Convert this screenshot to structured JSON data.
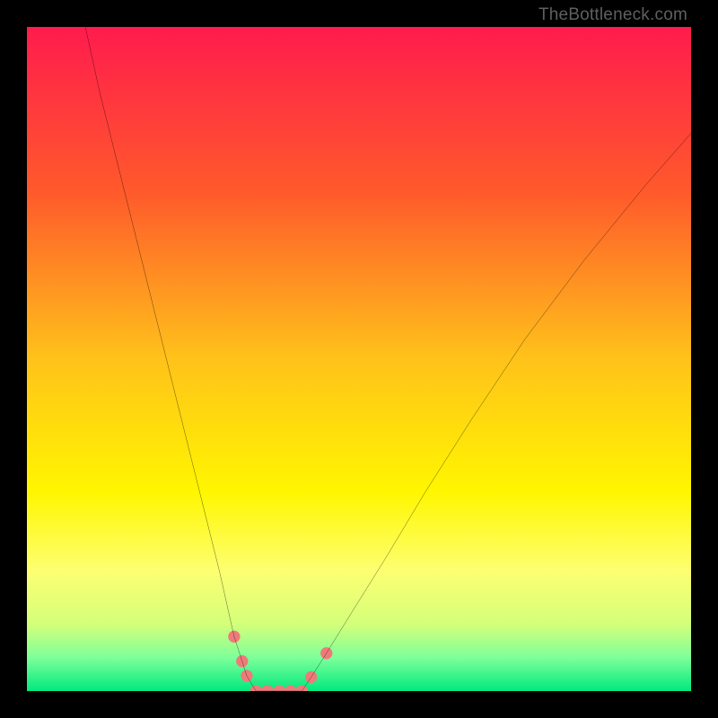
{
  "watermark": "TheBottleneck.com",
  "chart_data": {
    "type": "line",
    "title": "",
    "xlabel": "",
    "ylabel": "",
    "xlim": [
      0,
      100
    ],
    "ylim": [
      0,
      100
    ],
    "background_gradient_stops": [
      {
        "offset": 0.0,
        "color": "#ff1b4d"
      },
      {
        "offset": 0.25,
        "color": "#ff5a2b"
      },
      {
        "offset": 0.5,
        "color": "#ffc21a"
      },
      {
        "offset": 0.7,
        "color": "#fff600"
      },
      {
        "offset": 0.82,
        "color": "#fdff72"
      },
      {
        "offset": 0.9,
        "color": "#d3ff7a"
      },
      {
        "offset": 0.95,
        "color": "#7dff9a"
      },
      {
        "offset": 1.0,
        "color": "#00e97e"
      }
    ],
    "series": [
      {
        "name": "bottleneck-curve",
        "stroke": "#000000",
        "x": [
          8.8,
          11,
          14,
          17,
          20,
          23,
          26,
          29,
          31.2,
          32.4,
          33.1,
          34.5,
          36.2,
          38.0,
          39.7,
          41.4,
          42.8,
          45.1,
          49,
          54,
          60,
          67,
          75,
          84,
          93,
          100
        ],
        "values": [
          100,
          90,
          78,
          66,
          54,
          42,
          30,
          18,
          8.2,
          4.5,
          2.3,
          0.0,
          0.0,
          0.0,
          0.0,
          0.0,
          2.1,
          5.7,
          12,
          20,
          30,
          41,
          53,
          65,
          76,
          84
        ]
      }
    ],
    "markers": {
      "name": "curve-feet-markers",
      "color": "#ef7a7a",
      "radius_data_units": 0.9,
      "points": [
        {
          "x": 31.2,
          "y": 8.2
        },
        {
          "x": 32.4,
          "y": 4.5
        },
        {
          "x": 33.1,
          "y": 2.3
        },
        {
          "x": 34.5,
          "y": 0.0
        },
        {
          "x": 36.2,
          "y": 0.0
        },
        {
          "x": 38.0,
          "y": 0.0
        },
        {
          "x": 39.7,
          "y": 0.0
        },
        {
          "x": 41.4,
          "y": 0.0
        },
        {
          "x": 42.8,
          "y": 2.1
        },
        {
          "x": 45.1,
          "y": 5.7
        }
      ]
    }
  }
}
